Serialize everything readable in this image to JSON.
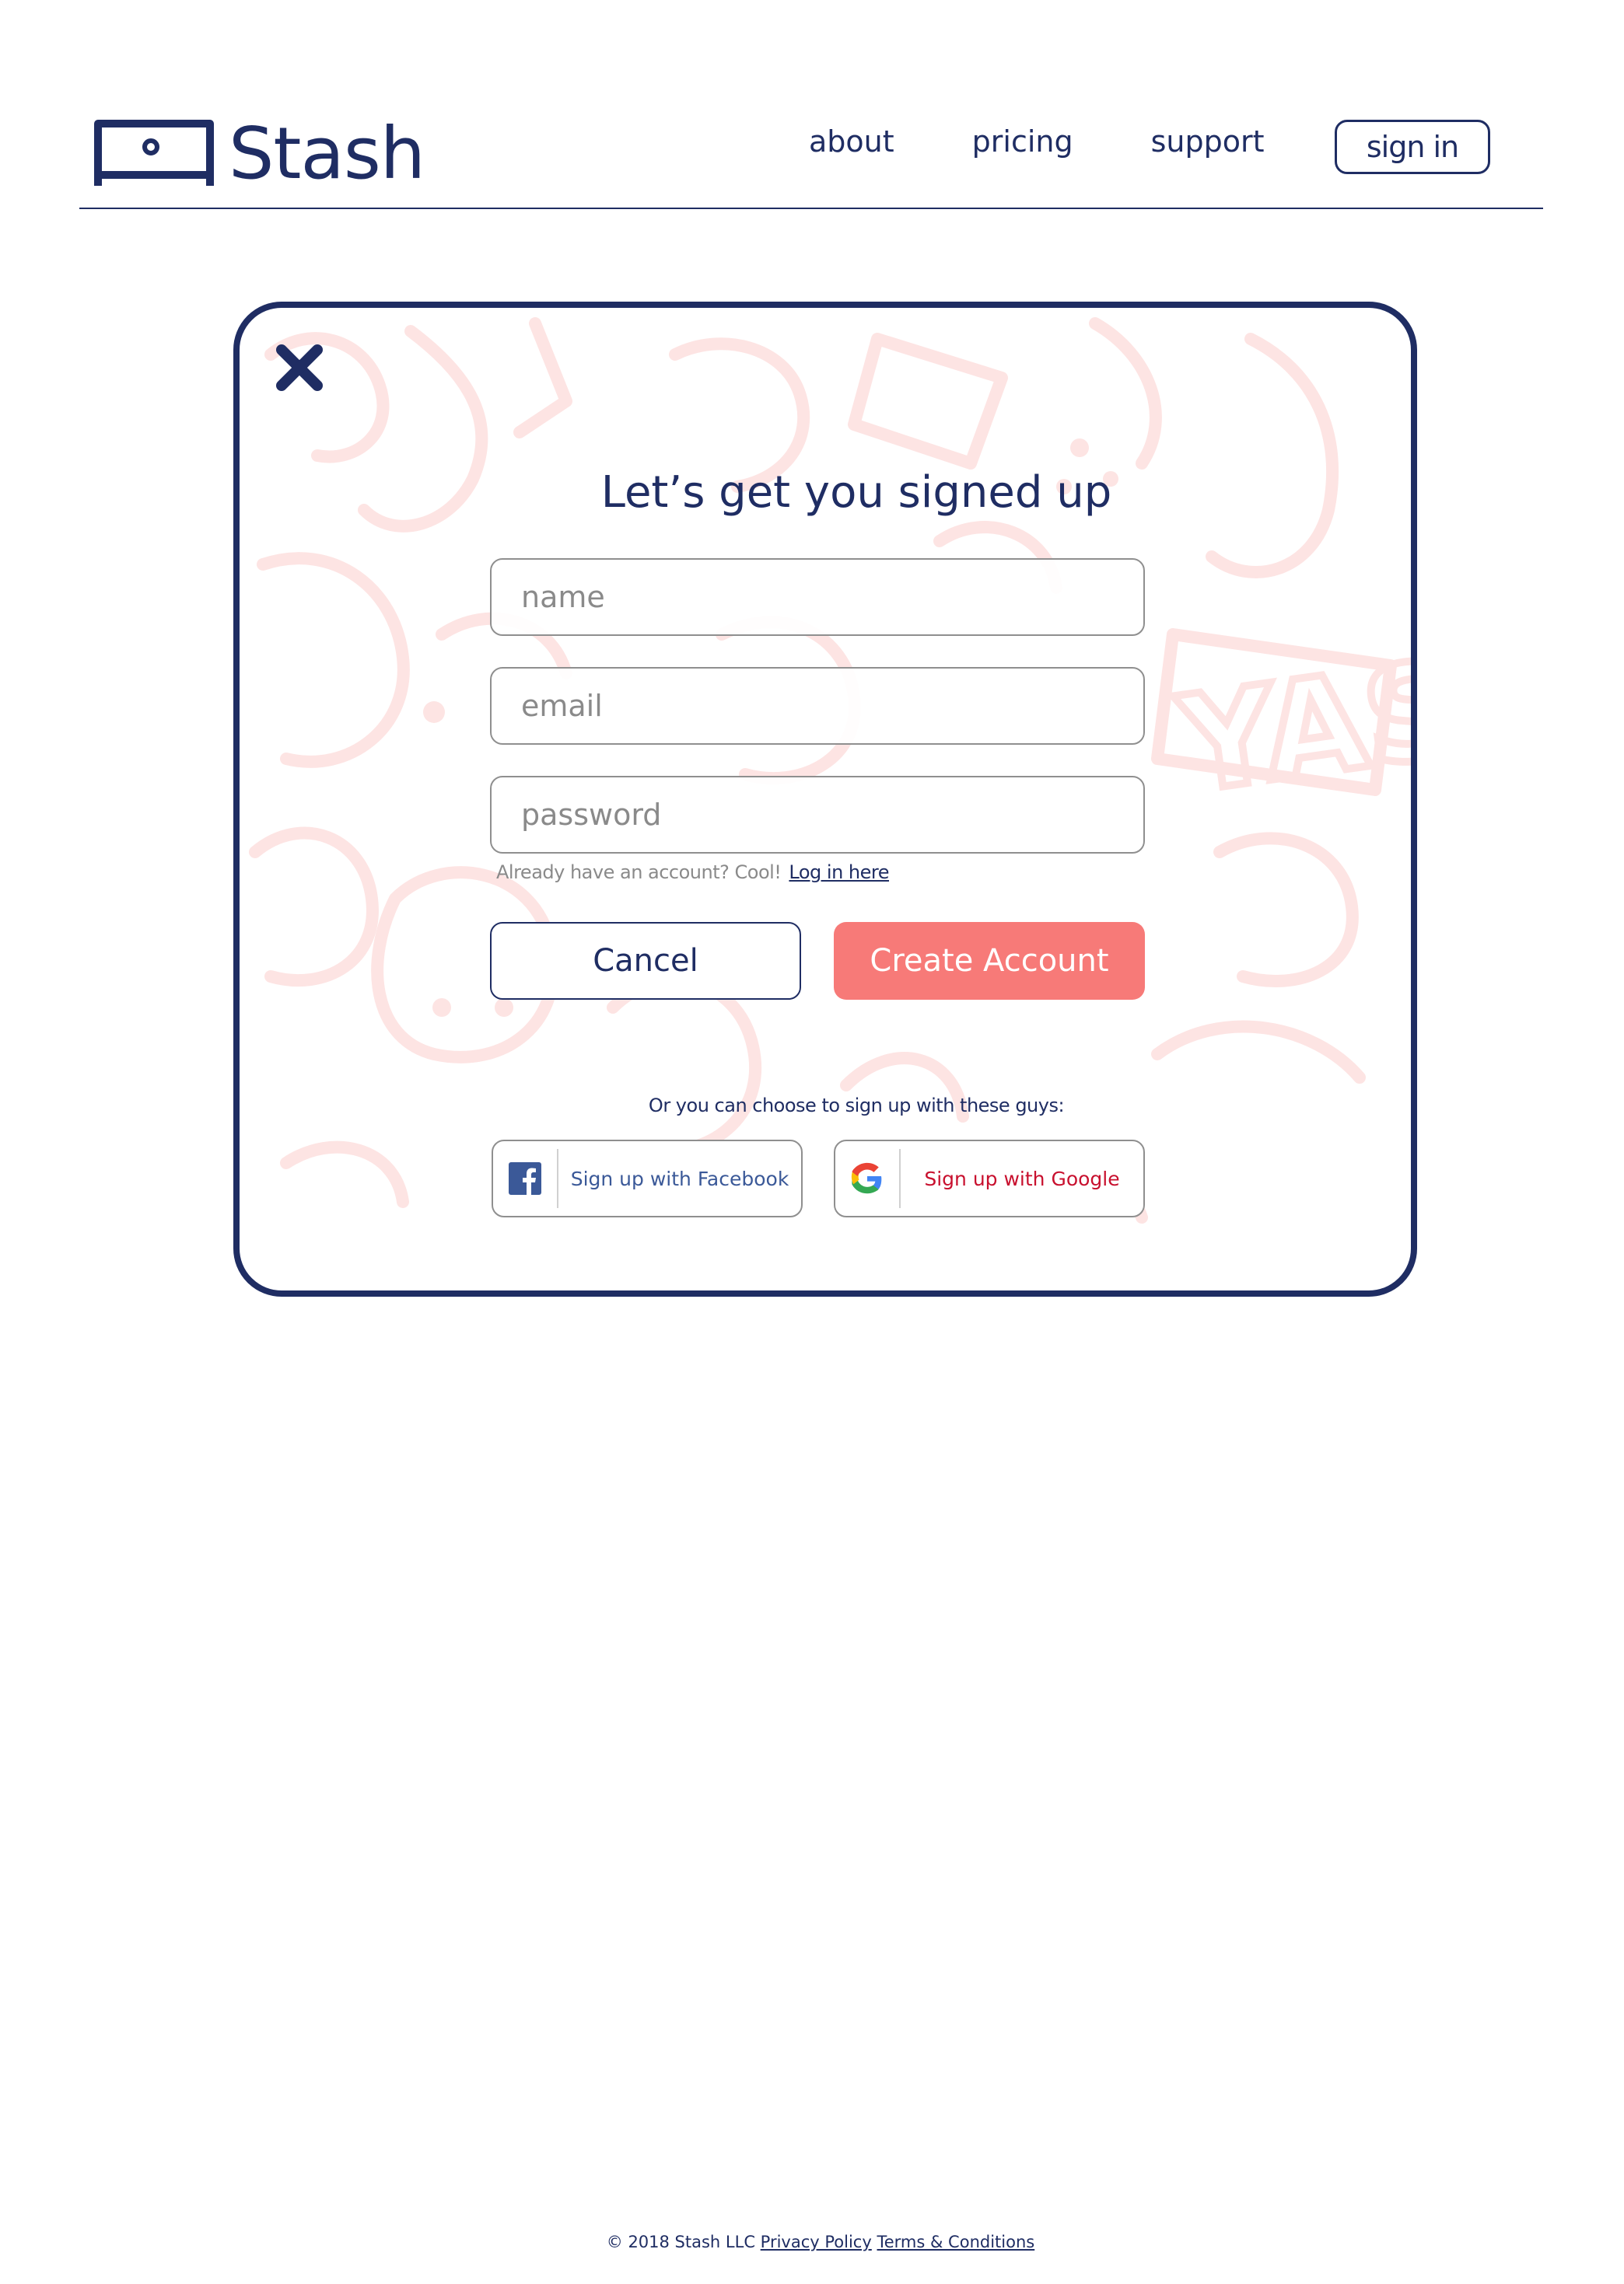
{
  "brand": {
    "name": "Stash",
    "logo_icon": "tv-stand-icon",
    "primary_color": "#1f2d63",
    "accent_color": "#f77a78"
  },
  "nav": {
    "items": [
      "about",
      "pricing",
      "support"
    ],
    "signin_label": "sign in"
  },
  "modal": {
    "title": "Let’s get you signed up",
    "close_icon": "close-icon",
    "fields": {
      "name_placeholder": "name",
      "email_placeholder": "email",
      "password_placeholder": "password"
    },
    "login_hint": "Already have an account? Cool!",
    "login_link": "Log in here",
    "cancel_label": "Cancel",
    "create_label": "Create Account",
    "social_prompt": "Or you can choose to sign up with these guys:",
    "facebook_label": "Sign up with Facebook",
    "google_label": "Sign up with Google",
    "background_doodle_text": "YAS",
    "doodle_color": "#fde4e3"
  },
  "footer": {
    "copyright": "© 2018 Stash LLC",
    "privacy": "Privacy Policy",
    "terms": "Terms & Conditions"
  }
}
